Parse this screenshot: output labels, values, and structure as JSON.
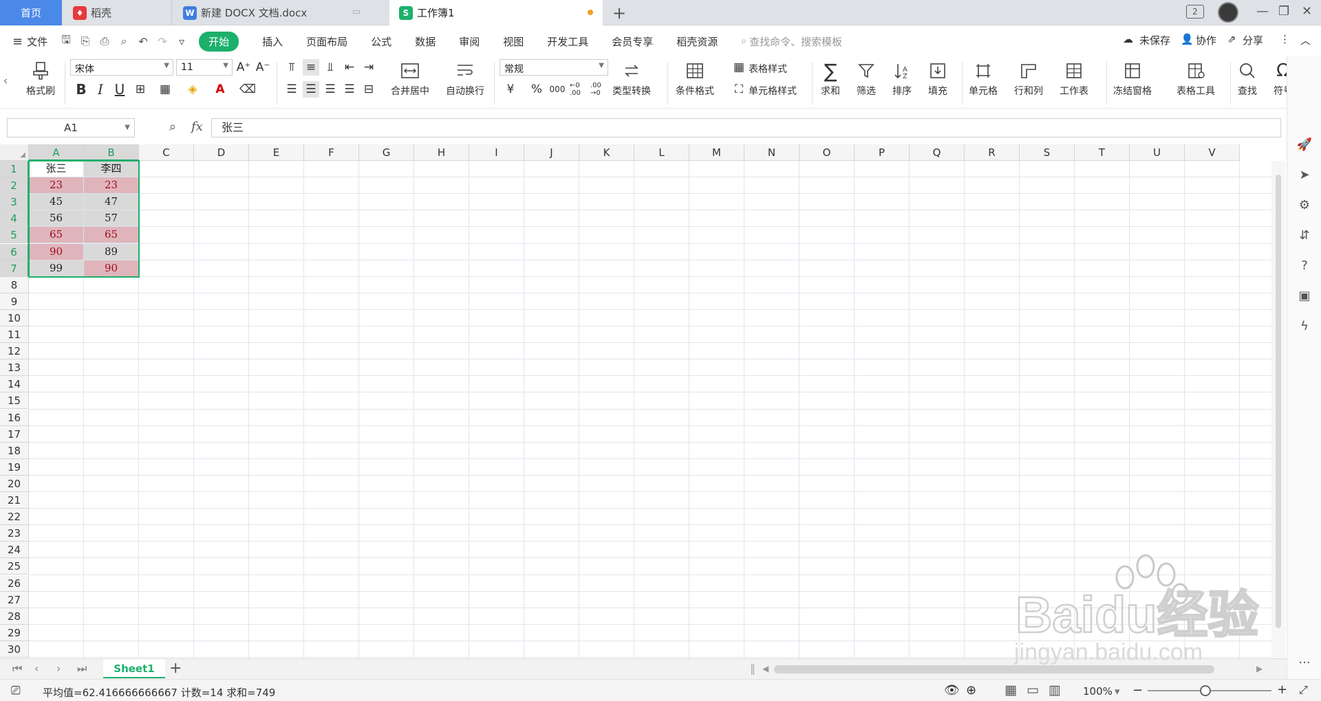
{
  "tabs": {
    "home": "首页",
    "daoke": "稻壳",
    "docx": "新建 DOCX 文档.docx",
    "book": "工作簿1",
    "new_tab": "+",
    "counter": "2"
  },
  "menu": {
    "file": "文件",
    "start": "开始",
    "items": [
      "插入",
      "页面布局",
      "公式",
      "数据",
      "审阅",
      "视图",
      "开发工具",
      "会员专享",
      "稻壳资源"
    ],
    "search": "查找命令、搜索模板",
    "unsaved": "未保存",
    "collab": "协作",
    "share": "分享"
  },
  "ribbon": {
    "format_painter": "格式刷",
    "font_name": "宋体",
    "font_size": "11",
    "merge_center": "合并居中",
    "wrap": "自动换行",
    "number_format": "常规",
    "type_convert": "类型转换",
    "cond_format": "条件格式",
    "table_style": "表格样式",
    "cell_style": "单元格样式",
    "sum": "求和",
    "filter": "筛选",
    "sort": "排序",
    "fill": "填充",
    "cell": "单元格",
    "rowcol": "行和列",
    "worksheet": "工作表",
    "freeze": "冻结窗格",
    "table_tools": "表格工具",
    "find": "查找",
    "symbol": "符号",
    "bold": "B",
    "italic": "I",
    "underline": "U",
    "currency": "¥",
    "percent": "%",
    "thousands": "000",
    "inc_dec": "←0 .00",
    "dec_dec": ".00 →0"
  },
  "formula_bar": {
    "name_box": "A1",
    "fx": "fx",
    "content": "张三"
  },
  "columns": [
    "A",
    "B",
    "C",
    "D",
    "E",
    "F",
    "G",
    "H",
    "I",
    "J",
    "K",
    "L",
    "M",
    "N",
    "O",
    "P",
    "Q",
    "R",
    "S",
    "T",
    "U",
    "V"
  ],
  "rows": [
    "1",
    "2",
    "3",
    "4",
    "5",
    "6",
    "7",
    "8",
    "9",
    "10",
    "11",
    "12",
    "13",
    "14",
    "15",
    "16",
    "17",
    "18",
    "19",
    "20",
    "21",
    "22",
    "23",
    "24",
    "25",
    "26",
    "27",
    "28",
    "29",
    "30"
  ],
  "cells": {
    "A": [
      "张三",
      "23",
      "45",
      "56",
      "65",
      "90",
      "99"
    ],
    "B": [
      "李四",
      "23",
      "47",
      "57",
      "65",
      "89",
      "90"
    ]
  },
  "cell_fill": {
    "A": [
      "white",
      "pink",
      "gray",
      "gray",
      "pink",
      "pink",
      "gray"
    ],
    "B": [
      "gray",
      "pink",
      "gray",
      "gray",
      "pink",
      "gray",
      "pink"
    ]
  },
  "colors": {
    "accent": "#1cb06b",
    "highlight_fill": "#dfb5bb",
    "highlight_text": "#a00b1e",
    "gray_fill": "#d9d9d9",
    "home_tab": "#4a89e8"
  },
  "sheet": {
    "name": "Sheet1",
    "add": "+"
  },
  "status": {
    "summary": "平均值=62.416666666667 计数=14 求和=749",
    "zoom": "100%"
  },
  "watermark": {
    "brand": "Baidu经验",
    "url": "jingyan.baidu.com"
  }
}
